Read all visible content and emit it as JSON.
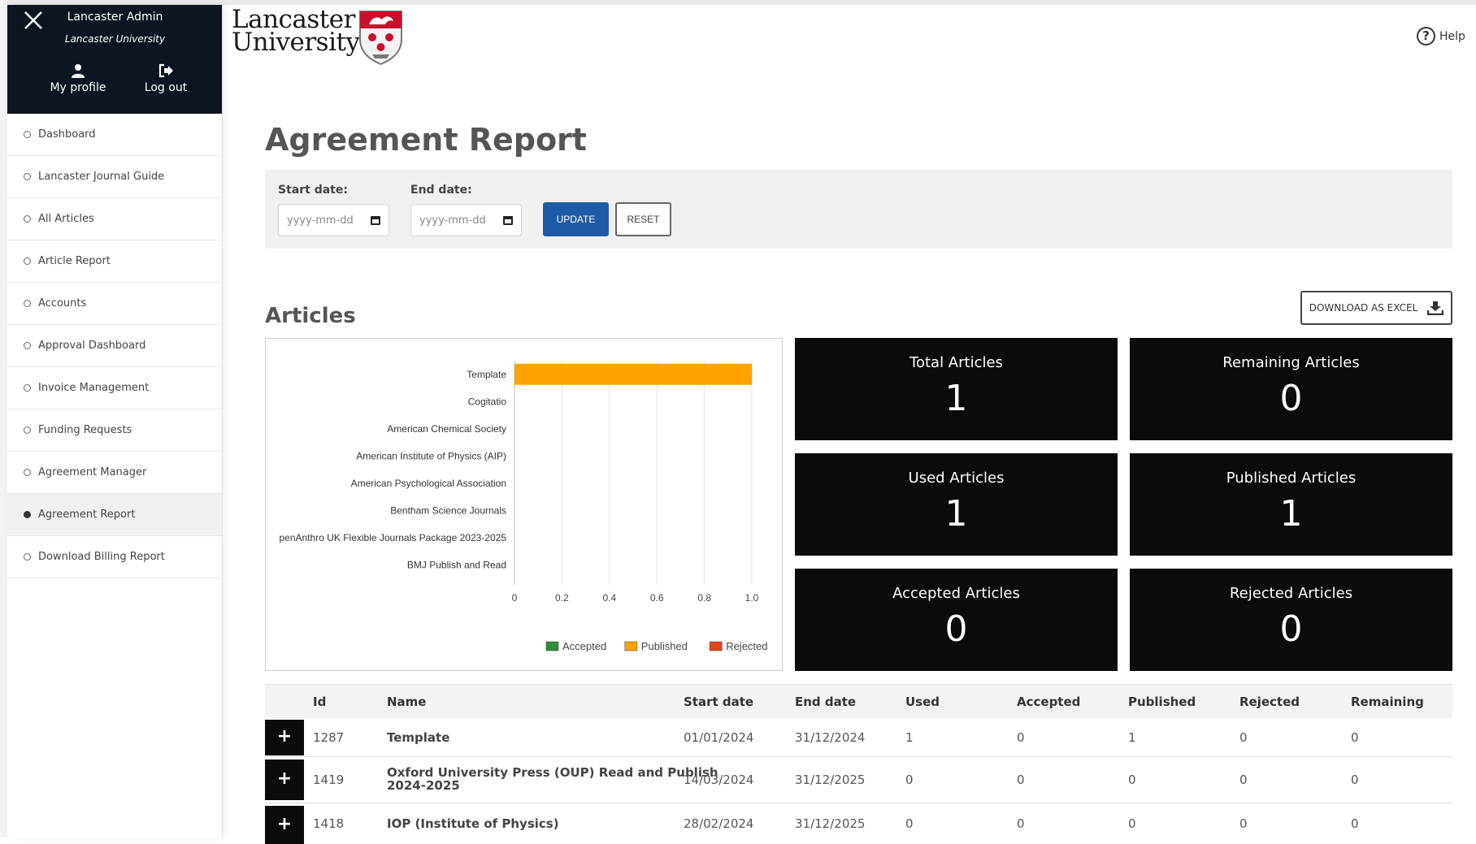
{
  "sidebar": {
    "user_name": "Lancaster Admin",
    "organisation": "Lancaster University",
    "profile_label": "My profile",
    "logout_label": "Log out",
    "items": [
      {
        "label": "Dashboard"
      },
      {
        "label": "Lancaster Journal Guide"
      },
      {
        "label": "All Articles"
      },
      {
        "label": "Article Report"
      },
      {
        "label": "Accounts"
      },
      {
        "label": "Approval Dashboard"
      },
      {
        "label": "Invoice Management"
      },
      {
        "label": "Funding Requests"
      },
      {
        "label": "Agreement Manager"
      },
      {
        "label": "Agreement Report"
      },
      {
        "label": "Download Billing Report"
      }
    ],
    "active_item": "Agreement Report"
  },
  "header": {
    "logo_line1": "Lancaster",
    "logo_line2": "University",
    "help_label": "Help"
  },
  "page": {
    "title": "Agreement Report"
  },
  "filter": {
    "start_label": "Start date:",
    "end_label": "End date:",
    "start_placeholder": "yyyy-mm-dd",
    "end_placeholder": "yyyy-mm-dd",
    "update_label": "UPDATE",
    "reset_label": "RESET"
  },
  "articles": {
    "section_title": "Articles",
    "download_label": "DOWNLOAD AS EXCEL"
  },
  "chart_data": {
    "type": "bar",
    "orientation": "horizontal",
    "stacked": true,
    "categories": [
      "Template",
      "Cogitatio",
      "American Chemical Society",
      "American Institute of Physics (AIP)",
      "American Psychological Association",
      "Bentham Science Journals",
      "penAnthro UK Flexible Journals Package 2023-2025",
      "BMJ Publish and Read"
    ],
    "series": [
      {
        "name": "Accepted",
        "color": "#2e8b3a",
        "values": [
          0,
          0,
          0,
          0,
          0,
          0,
          0,
          0
        ]
      },
      {
        "name": "Published",
        "color": "#ffa200",
        "values": [
          1,
          0,
          0,
          0,
          0,
          0,
          0,
          0
        ]
      },
      {
        "name": "Rejected",
        "color": "#e8431a",
        "values": [
          0,
          0,
          0,
          0,
          0,
          0,
          0,
          0
        ]
      }
    ],
    "xlim": [
      0,
      1.0
    ],
    "xticks": [
      "0",
      "0.2",
      "0.4",
      "0.6",
      "0.8",
      "1.0"
    ],
    "grid": "vertical",
    "legend_position": "bottom-right"
  },
  "stats": [
    {
      "label": "Total Articles",
      "value": "1"
    },
    {
      "label": "Remaining Articles",
      "value": "0"
    },
    {
      "label": "Used Articles",
      "value": "1"
    },
    {
      "label": "Published Articles",
      "value": "1"
    },
    {
      "label": "Accepted Articles",
      "value": "0"
    },
    {
      "label": "Rejected Articles",
      "value": "0"
    }
  ],
  "table": {
    "columns": [
      "Id",
      "Name",
      "Start date",
      "End date",
      "Used",
      "Accepted",
      "Published",
      "Rejected",
      "Remaining"
    ],
    "expand_symbol": "+",
    "rows": [
      {
        "id": "1287",
        "name": "Template",
        "start": "01/01/2024",
        "end": "31/12/2024",
        "used": "1",
        "accepted": "0",
        "published": "1",
        "rejected": "0",
        "remaining": "0"
      },
      {
        "id": "1419",
        "name_line1": "Oxford University Press (OUP) Read and Publish",
        "name_line2": "2024-2025",
        "start": "14/03/2024",
        "end": "31/12/2025",
        "used": "0",
        "accepted": "0",
        "published": "0",
        "rejected": "0",
        "remaining": "0"
      },
      {
        "id": "1418",
        "name": "IOP (Institute of Physics)",
        "start": "28/02/2024",
        "end": "31/12/2025",
        "used": "0",
        "accepted": "0",
        "published": "0",
        "rejected": "0",
        "remaining": "0"
      }
    ]
  }
}
